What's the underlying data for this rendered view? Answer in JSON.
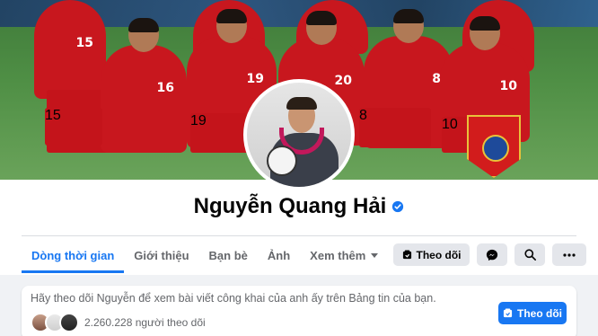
{
  "profile": {
    "name": "Nguyễn Quang Hải",
    "verified": true
  },
  "cover": {
    "jersey_numbers": [
      "15",
      "16",
      "19",
      "20",
      "8",
      "10",
      "15",
      "19",
      "8",
      "10"
    ]
  },
  "tabs": [
    {
      "label": "Dòng thời gian",
      "active": true
    },
    {
      "label": "Giới thiệu",
      "active": false
    },
    {
      "label": "Bạn bè",
      "active": false
    },
    {
      "label": "Ảnh",
      "active": false
    },
    {
      "label": "Xem thêm",
      "active": false
    }
  ],
  "actions": {
    "follow_label": "Theo dõi",
    "messenger_icon": "messenger-icon",
    "search_icon": "search-icon",
    "more_icon": "more-icon"
  },
  "follow_card": {
    "prompt": "Hãy theo dõi Nguyễn để xem bài viết công khai của anh ấy trên Bảng tin của bạn.",
    "follower_count": "2.260.228 người theo dõi",
    "button_label": "Theo dõi"
  },
  "colors": {
    "accent": "#1877f2",
    "background": "#f0f2f5",
    "button_gray": "#e4e6eb",
    "jersey_red": "#c8171e"
  }
}
